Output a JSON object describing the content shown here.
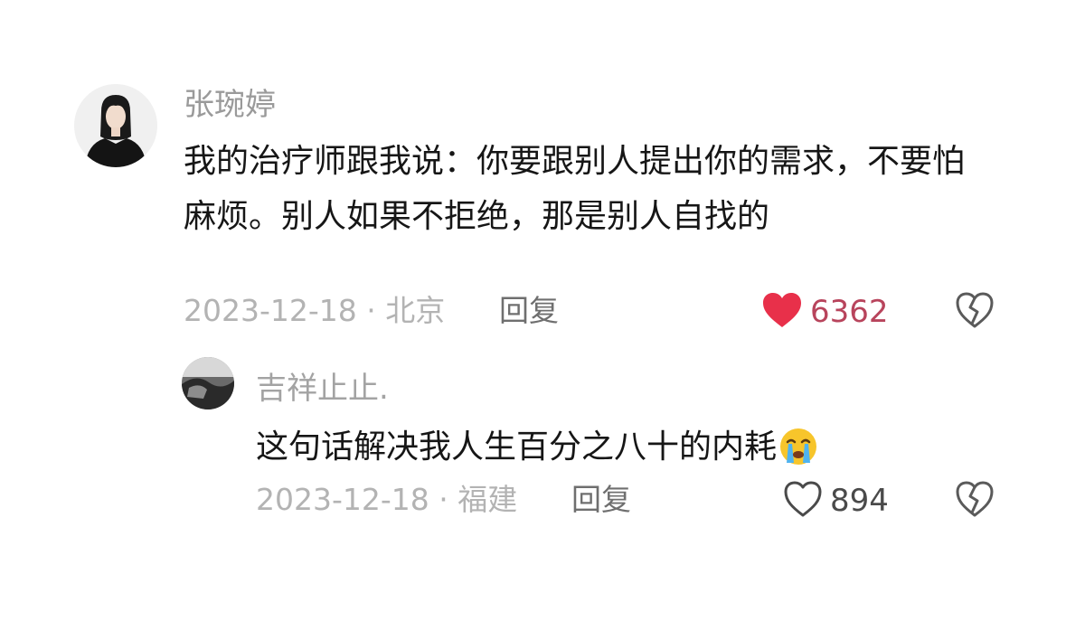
{
  "comments": [
    {
      "username": "张琬婷",
      "text": "我的治疗师跟我说：你要跟别人提出你的需求，不要怕麻烦。别人如果不拒绝，那是别人自找的",
      "meta": "2023-12-18 · 北京",
      "reply_label": "回复",
      "likes": "6362",
      "liked": true,
      "avatar_icon": "portrait-avatar-icon",
      "like_icon": "heart-filled-icon",
      "dislike_icon": "broken-heart-icon",
      "colors": {
        "like_active": "#e8304a"
      }
    },
    {
      "username": "吉祥止止.",
      "text": "这句话解决我人生百分之八十的内耗",
      "emoji_icon": "crying-face-emoji-icon",
      "meta": "2023-12-18 · 福建",
      "reply_label": "回复",
      "likes": "894",
      "liked": false,
      "avatar_icon": "photo-avatar-icon",
      "like_icon": "heart-outline-icon",
      "dislike_icon": "broken-heart-icon"
    }
  ]
}
